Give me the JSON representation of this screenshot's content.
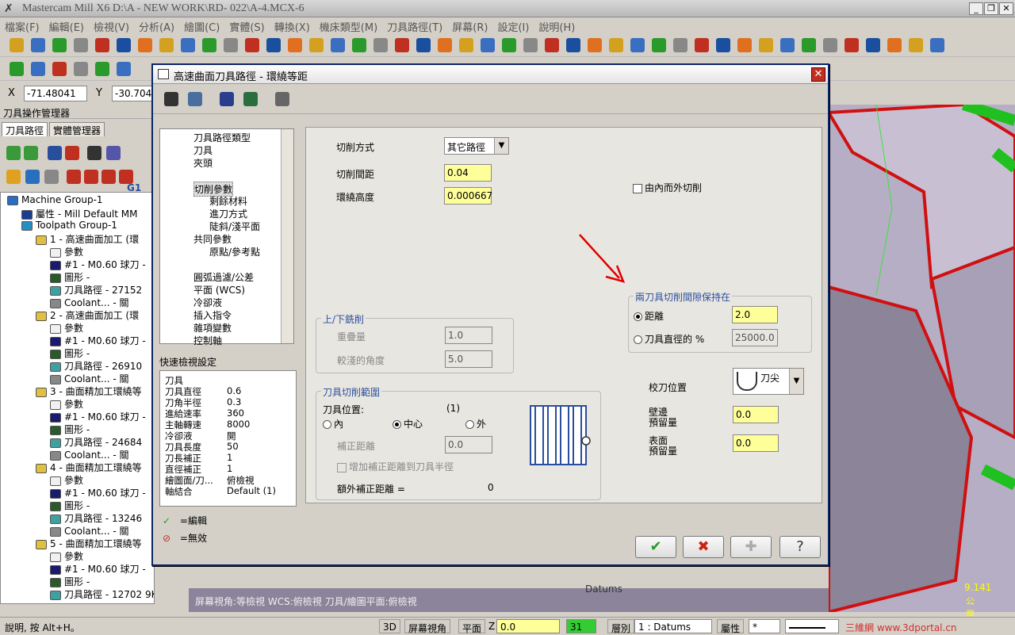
{
  "window": {
    "title": "Mastercam Mill X6  D:\\A - NEW WORK\\RD- 022\\A-4.MCX-6"
  },
  "menu": [
    "檔案(F)",
    "編輯(E)",
    "檢視(V)",
    "分析(A)",
    "繪圖(C)",
    "實體(S)",
    "轉換(X)",
    "機床類型(M)",
    "刀具路徑(T)",
    "屏幕(R)",
    "設定(I)",
    "說明(H)"
  ],
  "coords": {
    "x_label": "X",
    "x_value": "-71.48041",
    "y_label": "Y",
    "y_value": "-30.70429"
  },
  "left_panel": {
    "header": "刀具操作管理器",
    "tabs": [
      "刀具路徑",
      "實體管理器"
    ],
    "toolbar_text": "G1",
    "tree": [
      {
        "indent": 0,
        "icon": "machine",
        "text": "Machine Group-1"
      },
      {
        "indent": 1,
        "icon": "property",
        "text": "屬性 - Mill Default MM"
      },
      {
        "indent": 1,
        "icon": "group",
        "text": "Toolpath Group-1"
      },
      {
        "indent": 2,
        "icon": "folder",
        "text": "1 - 高速曲面加工 (環"
      },
      {
        "indent": 3,
        "icon": "param",
        "text": "參數"
      },
      {
        "indent": 3,
        "icon": "tool",
        "text": "#1 - M0.60 球刀 -"
      },
      {
        "indent": 3,
        "icon": "shape",
        "text": "圖形 -"
      },
      {
        "indent": 3,
        "icon": "path",
        "text": "刀具路徑 - 27152"
      },
      {
        "indent": 3,
        "icon": "coolant",
        "text": "Coolant... - 關"
      },
      {
        "indent": 2,
        "icon": "folder",
        "text": "2 - 高速曲面加工 (環"
      },
      {
        "indent": 3,
        "icon": "param",
        "text": "參數"
      },
      {
        "indent": 3,
        "icon": "tool",
        "text": "#1 - M0.60 球刀 -"
      },
      {
        "indent": 3,
        "icon": "shape",
        "text": "圖形 -"
      },
      {
        "indent": 3,
        "icon": "path",
        "text": "刀具路徑 - 26910"
      },
      {
        "indent": 3,
        "icon": "coolant",
        "text": "Coolant... - 關"
      },
      {
        "indent": 2,
        "icon": "folder",
        "text": "3 - 曲面精加工環繞等"
      },
      {
        "indent": 3,
        "icon": "param",
        "text": "參數"
      },
      {
        "indent": 3,
        "icon": "tool",
        "text": "#1 - M0.60 球刀 -"
      },
      {
        "indent": 3,
        "icon": "shape",
        "text": "圖形 -"
      },
      {
        "indent": 3,
        "icon": "path",
        "text": "刀具路徑 - 24684"
      },
      {
        "indent": 3,
        "icon": "coolant",
        "text": "Coolant... - 關"
      },
      {
        "indent": 2,
        "icon": "folder",
        "text": "4 - 曲面精加工環繞等"
      },
      {
        "indent": 3,
        "icon": "param",
        "text": "參數"
      },
      {
        "indent": 3,
        "icon": "tool",
        "text": "#1 - M0.60 球刀 -"
      },
      {
        "indent": 3,
        "icon": "shape",
        "text": "圖形 -"
      },
      {
        "indent": 3,
        "icon": "path",
        "text": "刀具路徑 - 13246"
      },
      {
        "indent": 3,
        "icon": "coolant",
        "text": "Coolant... - 關"
      },
      {
        "indent": 2,
        "icon": "folder",
        "text": "5 - 曲面精加工環繞等"
      },
      {
        "indent": 3,
        "icon": "param",
        "text": "參數"
      },
      {
        "indent": 3,
        "icon": "tool",
        "text": "#1 - M0.60 球刀 -"
      },
      {
        "indent": 3,
        "icon": "shape",
        "text": "圖形 -"
      },
      {
        "indent": 3,
        "icon": "path",
        "text": "刀具路徑 - 12702 9K"
      }
    ]
  },
  "dialog": {
    "title": "高速曲面刀具路徑 - 環繞等距",
    "nav": [
      {
        "indent": 1,
        "text": "刀具路徑類型"
      },
      {
        "indent": 1,
        "text": "刀具"
      },
      {
        "indent": 1,
        "text": "夾頭"
      },
      {
        "indent": 1,
        "text": ""
      },
      {
        "indent": 1,
        "text": "切削參數",
        "selected": true
      },
      {
        "indent": 2,
        "text": "剩餘材料"
      },
      {
        "indent": 2,
        "text": "進刀方式"
      },
      {
        "indent": 2,
        "text": "陡斜/淺平面"
      },
      {
        "indent": 1,
        "text": "共同參數"
      },
      {
        "indent": 2,
        "text": "原點/參考點"
      },
      {
        "indent": 1,
        "text": ""
      },
      {
        "indent": 1,
        "text": "圓弧過濾/公差"
      },
      {
        "indent": 1,
        "text": "平面 (WCS)"
      },
      {
        "indent": 1,
        "text": "冷卻液"
      },
      {
        "indent": 1,
        "text": "插入指令"
      },
      {
        "indent": 1,
        "text": "雜項變數"
      },
      {
        "indent": 1,
        "text": "控制軸"
      }
    ],
    "quickview": {
      "title": "快速檢視設定",
      "rows": [
        [
          "刀具",
          ""
        ],
        [
          "刀具直徑",
          "0.6"
        ],
        [
          "刀角半徑",
          "0.3"
        ],
        [
          "進給速率",
          "360"
        ],
        [
          "主軸轉速",
          "8000"
        ],
        [
          "冷卻液",
          "開"
        ],
        [
          "刀具長度",
          "50"
        ],
        [
          "刀長補正",
          "1"
        ],
        [
          "直徑補正",
          "1"
        ],
        [
          "繪圖面/刀...",
          "俯檢視"
        ],
        [
          "軸結合",
          "Default (1)"
        ]
      ]
    },
    "legend": {
      "edit": "=編輯",
      "invalid": "=無效"
    },
    "cut_method_label": "切削方式",
    "cut_method_value": "其它路徑",
    "stepover_label": "切削間距",
    "stepover_value": "0.04",
    "scallop_label": "環繞高度",
    "scallop_value": "0.000667",
    "inside_out_label": "由內而外切削",
    "updown": {
      "title": "上/下銑削",
      "overlap_label": "重疊量",
      "overlap_value": "1.0",
      "angle_label": "較淺的角度",
      "angle_value": "5.0"
    },
    "keep": {
      "title": "兩刀具切削間隙保持在",
      "distance_label": "距離",
      "distance_value": "2.0",
      "percent_label": "刀具直徑的 %",
      "percent_value": "25000.0"
    },
    "containment": {
      "title": "刀具切削範圍",
      "pos_label": "刀具位置:",
      "pos_count": "(1)",
      "inside": "內",
      "center": "中心",
      "outside": "外",
      "comp_label": "補正距離",
      "comp_value": "0.0",
      "add_comp_label": "增加補正距離到刀具半徑",
      "extra_label": "額外補正距離 =",
      "extra_value": "0"
    },
    "tip": {
      "label": "校刀位置",
      "value": "刀尖"
    },
    "wall_stock": {
      "label1": "壁邊",
      "label2": "預留量",
      "value": "0.0"
    },
    "floor_stock": {
      "label1": "表面",
      "label2": "預留量",
      "value": "0.0"
    }
  },
  "viewport": {
    "status": "屏幕視角:等檢視    WCS:俯檢視    刀具/繪圖平面:俯檢視",
    "datums": "Datums",
    "scale_value": "9.141",
    "scale_unit": "公厘"
  },
  "statusbar": {
    "help": "說明, 按 Alt+H。",
    "mode": "3D",
    "screen_view": "屏幕視角",
    "plane": "平面",
    "z_label": "Z",
    "z_value": "0.0",
    "level_value": "31",
    "level_label": "層別",
    "level_name": "1 : Datums",
    "attr": "屬性",
    "star": "*",
    "watermark": "三維網 www.3dportal.cn"
  }
}
